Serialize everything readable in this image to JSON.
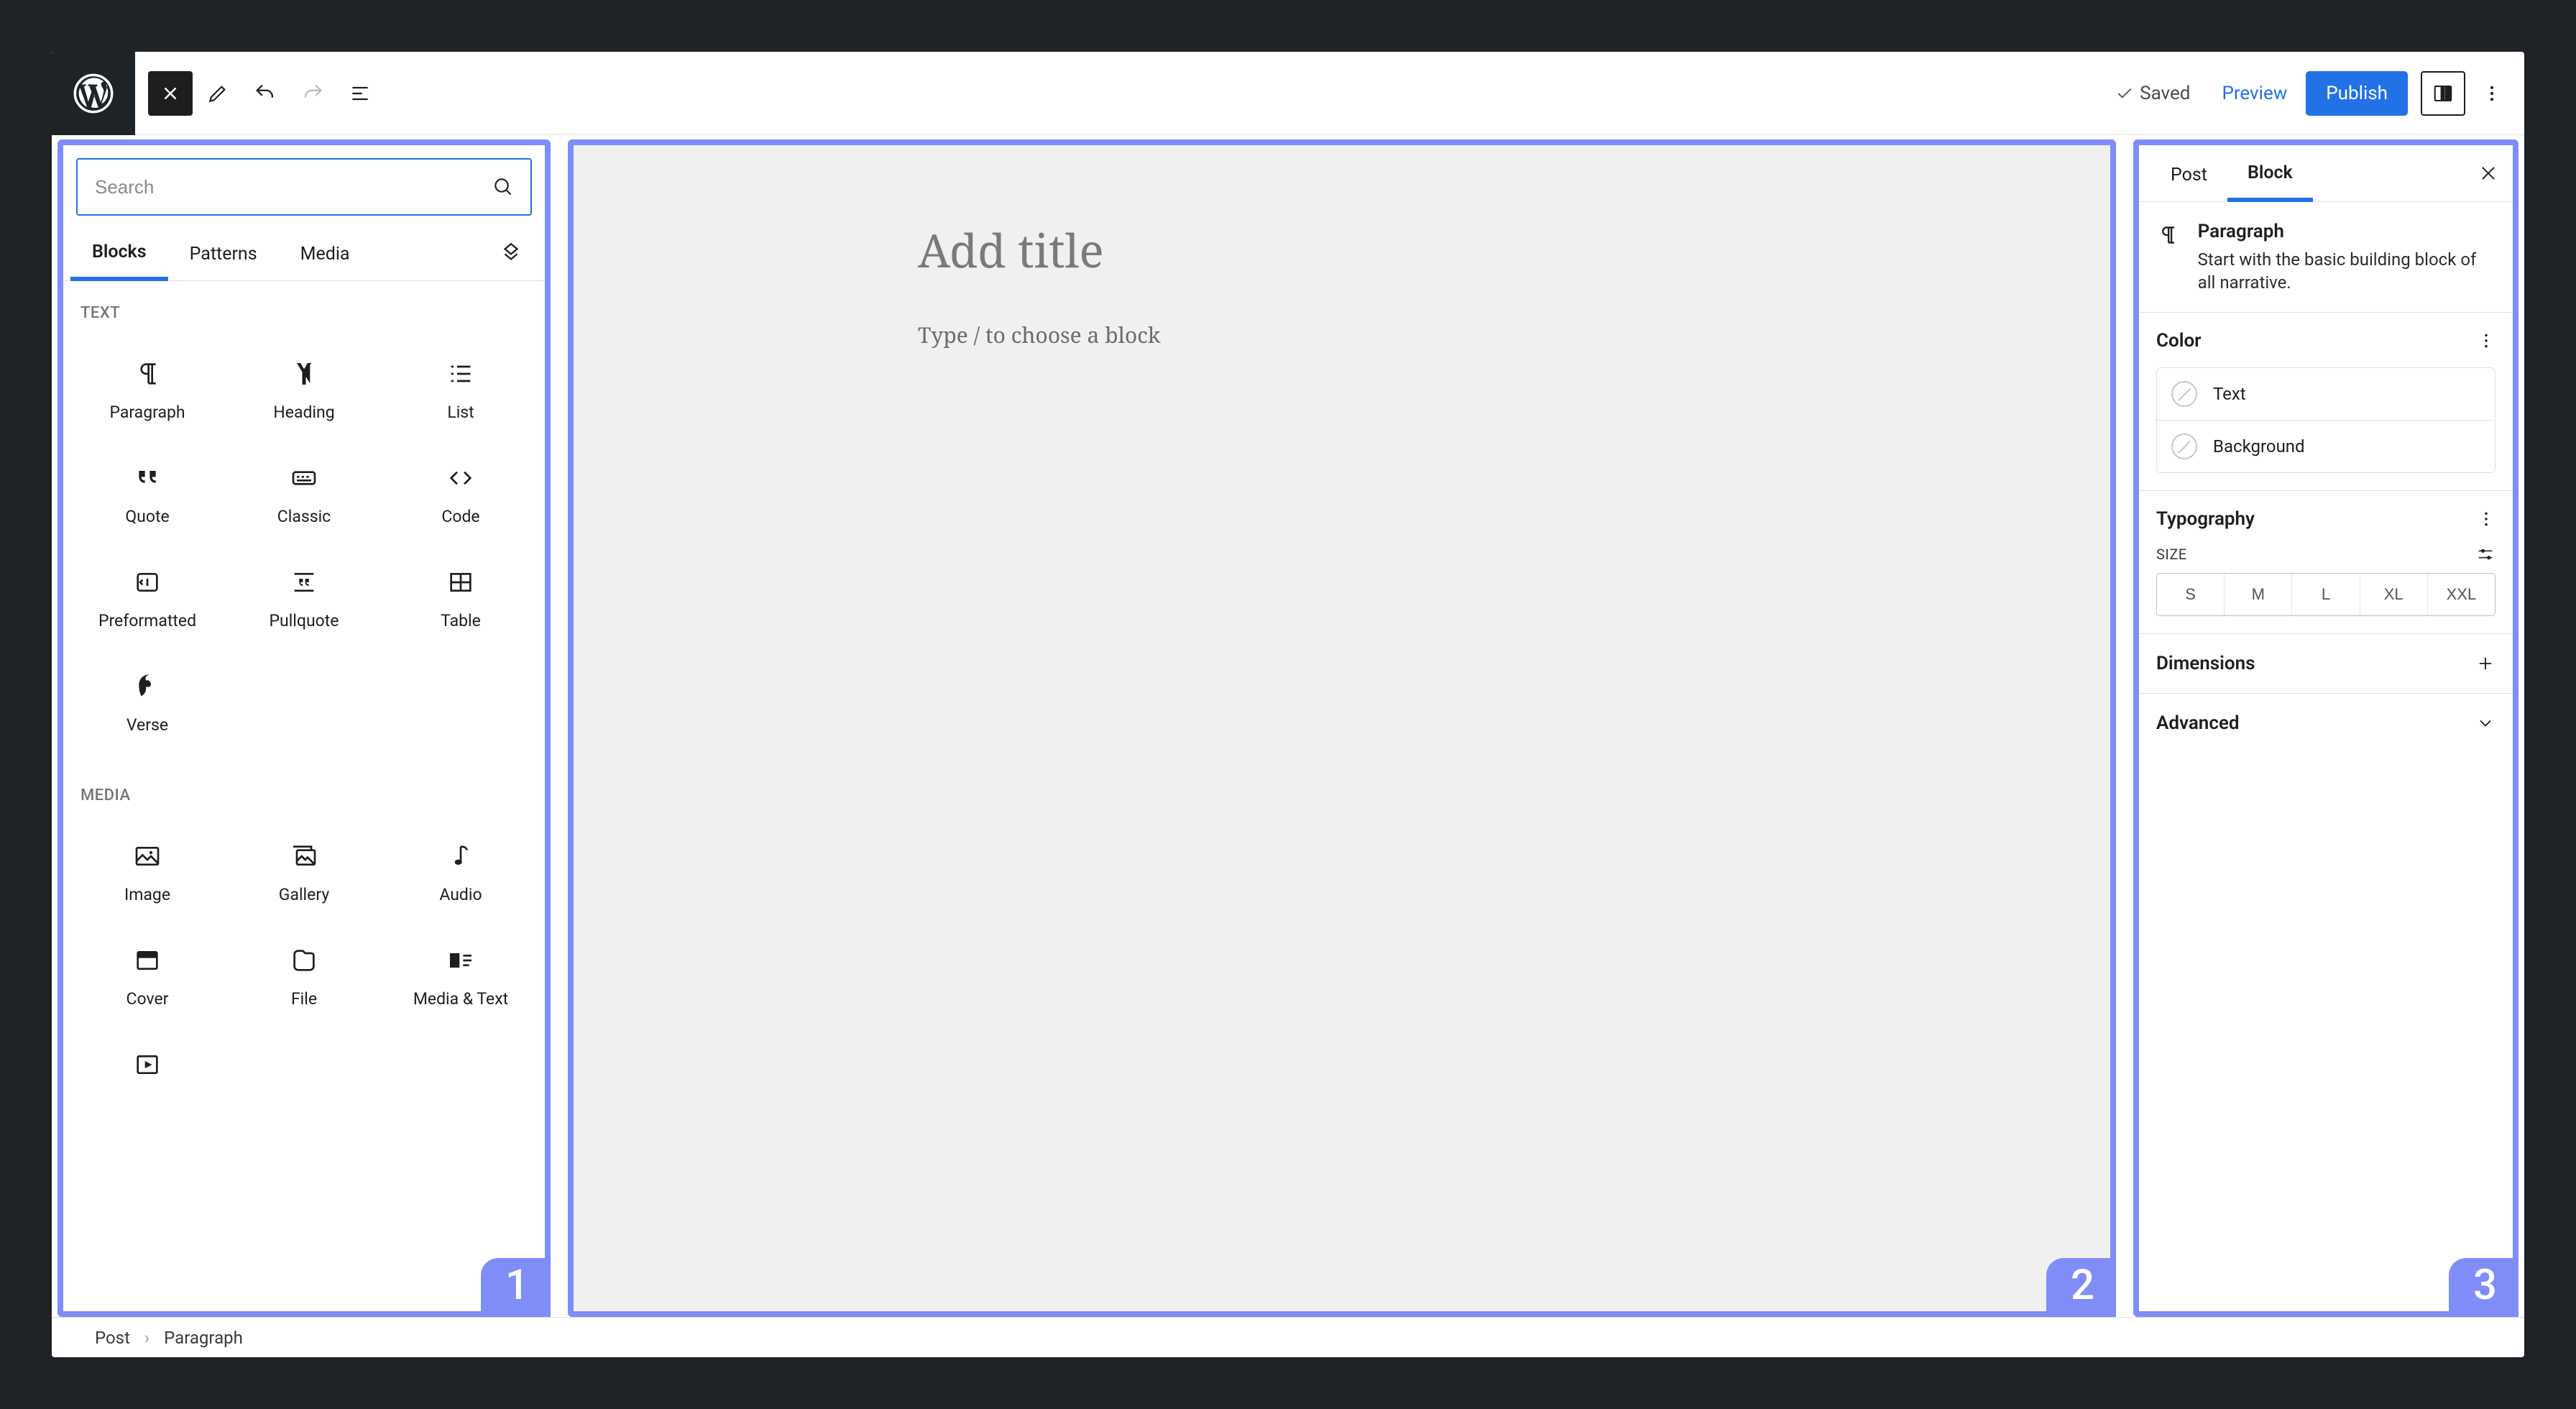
{
  "topbar": {
    "saved_label": "Saved",
    "preview_label": "Preview",
    "publish_label": "Publish"
  },
  "inserter": {
    "search_placeholder": "Search",
    "tabs": {
      "blocks": "Blocks",
      "patterns": "Patterns",
      "media": "Media"
    },
    "section_text": "TEXT",
    "section_media": "MEDIA",
    "text_blocks": [
      {
        "id": "paragraph",
        "label": "Paragraph"
      },
      {
        "id": "heading",
        "label": "Heading"
      },
      {
        "id": "list",
        "label": "List"
      },
      {
        "id": "quote",
        "label": "Quote"
      },
      {
        "id": "classic",
        "label": "Classic"
      },
      {
        "id": "code",
        "label": "Code"
      },
      {
        "id": "preformatted",
        "label": "Preformatted"
      },
      {
        "id": "pullquote",
        "label": "Pullquote"
      },
      {
        "id": "table",
        "label": "Table"
      },
      {
        "id": "verse",
        "label": "Verse"
      }
    ],
    "media_blocks": [
      {
        "id": "image",
        "label": "Image"
      },
      {
        "id": "gallery",
        "label": "Gallery"
      },
      {
        "id": "audio",
        "label": "Audio"
      },
      {
        "id": "cover",
        "label": "Cover"
      },
      {
        "id": "file",
        "label": "File"
      },
      {
        "id": "media-text",
        "label": "Media & Text"
      },
      {
        "id": "video",
        "label": ""
      }
    ]
  },
  "canvas": {
    "title_placeholder": "Add title",
    "paragraph_placeholder": "Type / to choose a block"
  },
  "settings": {
    "tabs": {
      "post": "Post",
      "block": "Block"
    },
    "block_name": "Paragraph",
    "block_desc": "Start with the basic building block of all narrative.",
    "color_title": "Color",
    "color_text": "Text",
    "color_bg": "Background",
    "typo_title": "Typography",
    "size_label": "SIZE",
    "sizes": [
      "S",
      "M",
      "L",
      "XL",
      "XXL"
    ],
    "dimensions_title": "Dimensions",
    "advanced_title": "Advanced"
  },
  "breadcrumb": {
    "root": "Post",
    "current": "Paragraph"
  },
  "annotation": {
    "one": "1",
    "two": "2",
    "three": "3"
  }
}
